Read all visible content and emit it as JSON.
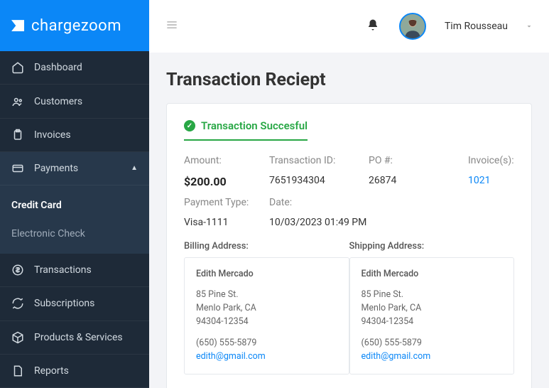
{
  "brand": {
    "name": "chargezoom"
  },
  "user": {
    "name": "Tim Rousseau"
  },
  "sidebar": {
    "items": [
      {
        "label": "Dashboard"
      },
      {
        "label": "Customers"
      },
      {
        "label": "Invoices"
      },
      {
        "label": "Payments"
      },
      {
        "label": "Transactions"
      },
      {
        "label": "Subscriptions"
      },
      {
        "label": "Products & Services"
      },
      {
        "label": "Reports"
      }
    ],
    "payments_sub": [
      {
        "label": "Credit Card"
      },
      {
        "label": "Electronic Check"
      }
    ]
  },
  "page": {
    "title": "Transaction Reciept",
    "status": "Transaction Succesful",
    "fields": {
      "amount_label": "Amount:",
      "amount_value": "$200.00",
      "txid_label": "Transaction ID:",
      "txid_value": "7651934304",
      "po_label": "PO #:",
      "po_value": "26874",
      "inv_label": "Invoice(s):",
      "inv_value": "1021",
      "ptype_label": "Payment Type:",
      "ptype_value": "Visa-1111",
      "date_label": "Date:",
      "date_value": "10/03/2023 01:49 PM"
    },
    "billing": {
      "title": "Billing Address:",
      "name": "Edith Mercado",
      "line1": "85 Pine St.",
      "line2": "Menlo Park, CA",
      "line3": "94304-12354",
      "phone": "(650) 555-5879",
      "email": "edith@gmail.com"
    },
    "shipping": {
      "title": "Shipping Address:",
      "name": "Edith Mercado",
      "line1": "85 Pine St.",
      "line2": "Menlo Park, CA",
      "line3": "94304-12354",
      "phone": "(650) 555-5879",
      "email": "edith@gmail.com"
    }
  }
}
